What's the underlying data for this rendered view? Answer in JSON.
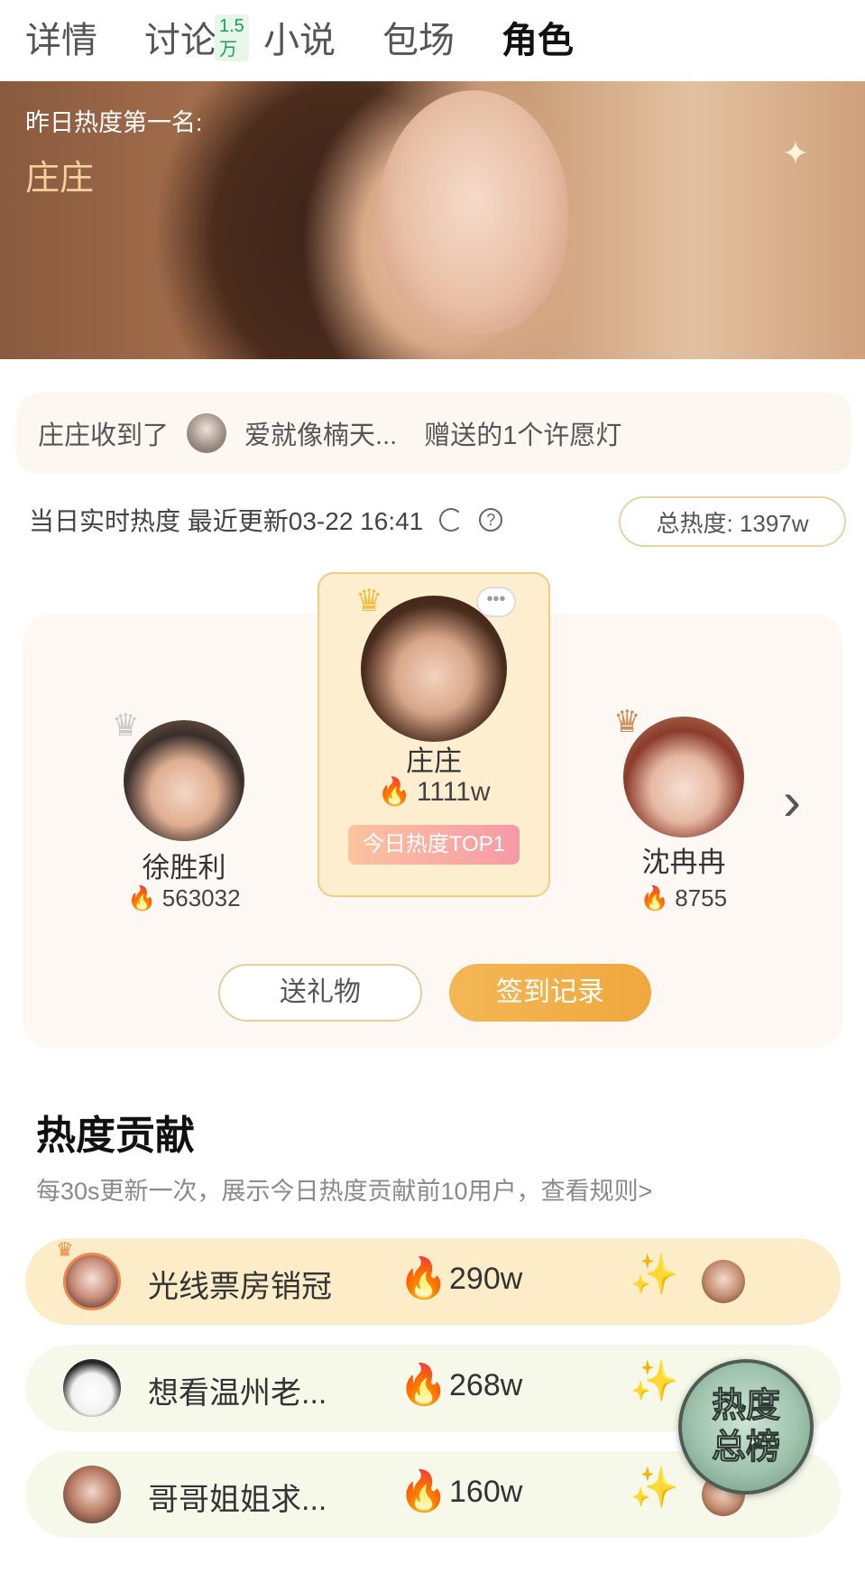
{
  "tabs": [
    {
      "label": "详情"
    },
    {
      "label": "讨论",
      "badge": "1.5万"
    },
    {
      "label": "小说"
    },
    {
      "label": "包场"
    },
    {
      "label": "角色",
      "active": true
    }
  ],
  "hero": {
    "label": "昨日热度第一名:",
    "name": "庄庄"
  },
  "gift_notice": {
    "prefix": "庄庄收到了",
    "sender": "爱就像楠天...",
    "suffix": "赠送的1个许愿灯"
  },
  "realtime": {
    "label": "当日实时热度 最近更新03-22 16:41",
    "total": "总热度: 1397w"
  },
  "ranking": {
    "first": {
      "name": "庄庄",
      "score": "1111w",
      "tag": "今日热度TOP1"
    },
    "second": {
      "name": "徐胜利",
      "score": "563032"
    },
    "third": {
      "name": "沈冉冉",
      "score": "8755"
    },
    "gift_button": "送礼物",
    "sign_button": "签到记录"
  },
  "contribution": {
    "title": "热度贡献",
    "subtitle": "每30s更新一次，展示今日热度贡献前10用户，查看规则>",
    "rows": [
      {
        "name": "光线票房销冠",
        "score": "290w"
      },
      {
        "name": "想看温州老...",
        "score": "268w"
      },
      {
        "name": "哥哥姐姐求...",
        "score": "160w"
      }
    ]
  },
  "float_badge": {
    "line1": "热度",
    "line2": "总榜"
  },
  "colors": {
    "accent_orange": "#efa73e",
    "flame": "#f26a1b",
    "top_card_bg": "#fdeed0"
  }
}
